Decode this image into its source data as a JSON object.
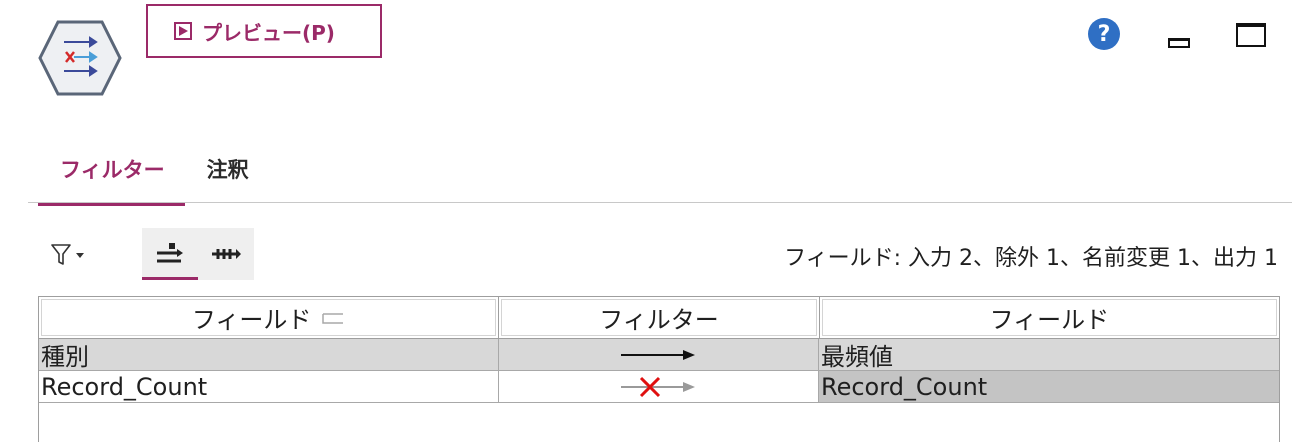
{
  "toolbar": {
    "preview_label": "プレビュー(P)",
    "node_icon": "filter-node-icon",
    "help_icon": "help-icon",
    "minimize_icon": "minimize-icon",
    "maximize_icon": "maximize-icon"
  },
  "tabs": [
    {
      "label": "フィルター",
      "active": true
    },
    {
      "label": "注釈",
      "active": false
    }
  ],
  "filter_toolbar": {
    "filter_icon": "filter-funnel-icon",
    "mode_buttons": [
      {
        "icon": "filter-mode-icon",
        "active": true
      },
      {
        "icon": "rename-mode-icon",
        "active": false
      }
    ],
    "status": "フィールド: 入力 2、除外 1、名前変更 1、出力 1"
  },
  "grid": {
    "headers": [
      "フィールド",
      "フィルター",
      "フィールド"
    ],
    "rows": [
      {
        "input": "種別",
        "filter": "pass",
        "output": "最頻値"
      },
      {
        "input": "Record_Count",
        "filter": "removed",
        "output": "Record_Count"
      }
    ]
  },
  "colors": {
    "accent": "#9b2a68",
    "help": "#2f6fc4",
    "row_shaded": "#d8d8d8",
    "selected_cell": "#c4c4c4"
  }
}
